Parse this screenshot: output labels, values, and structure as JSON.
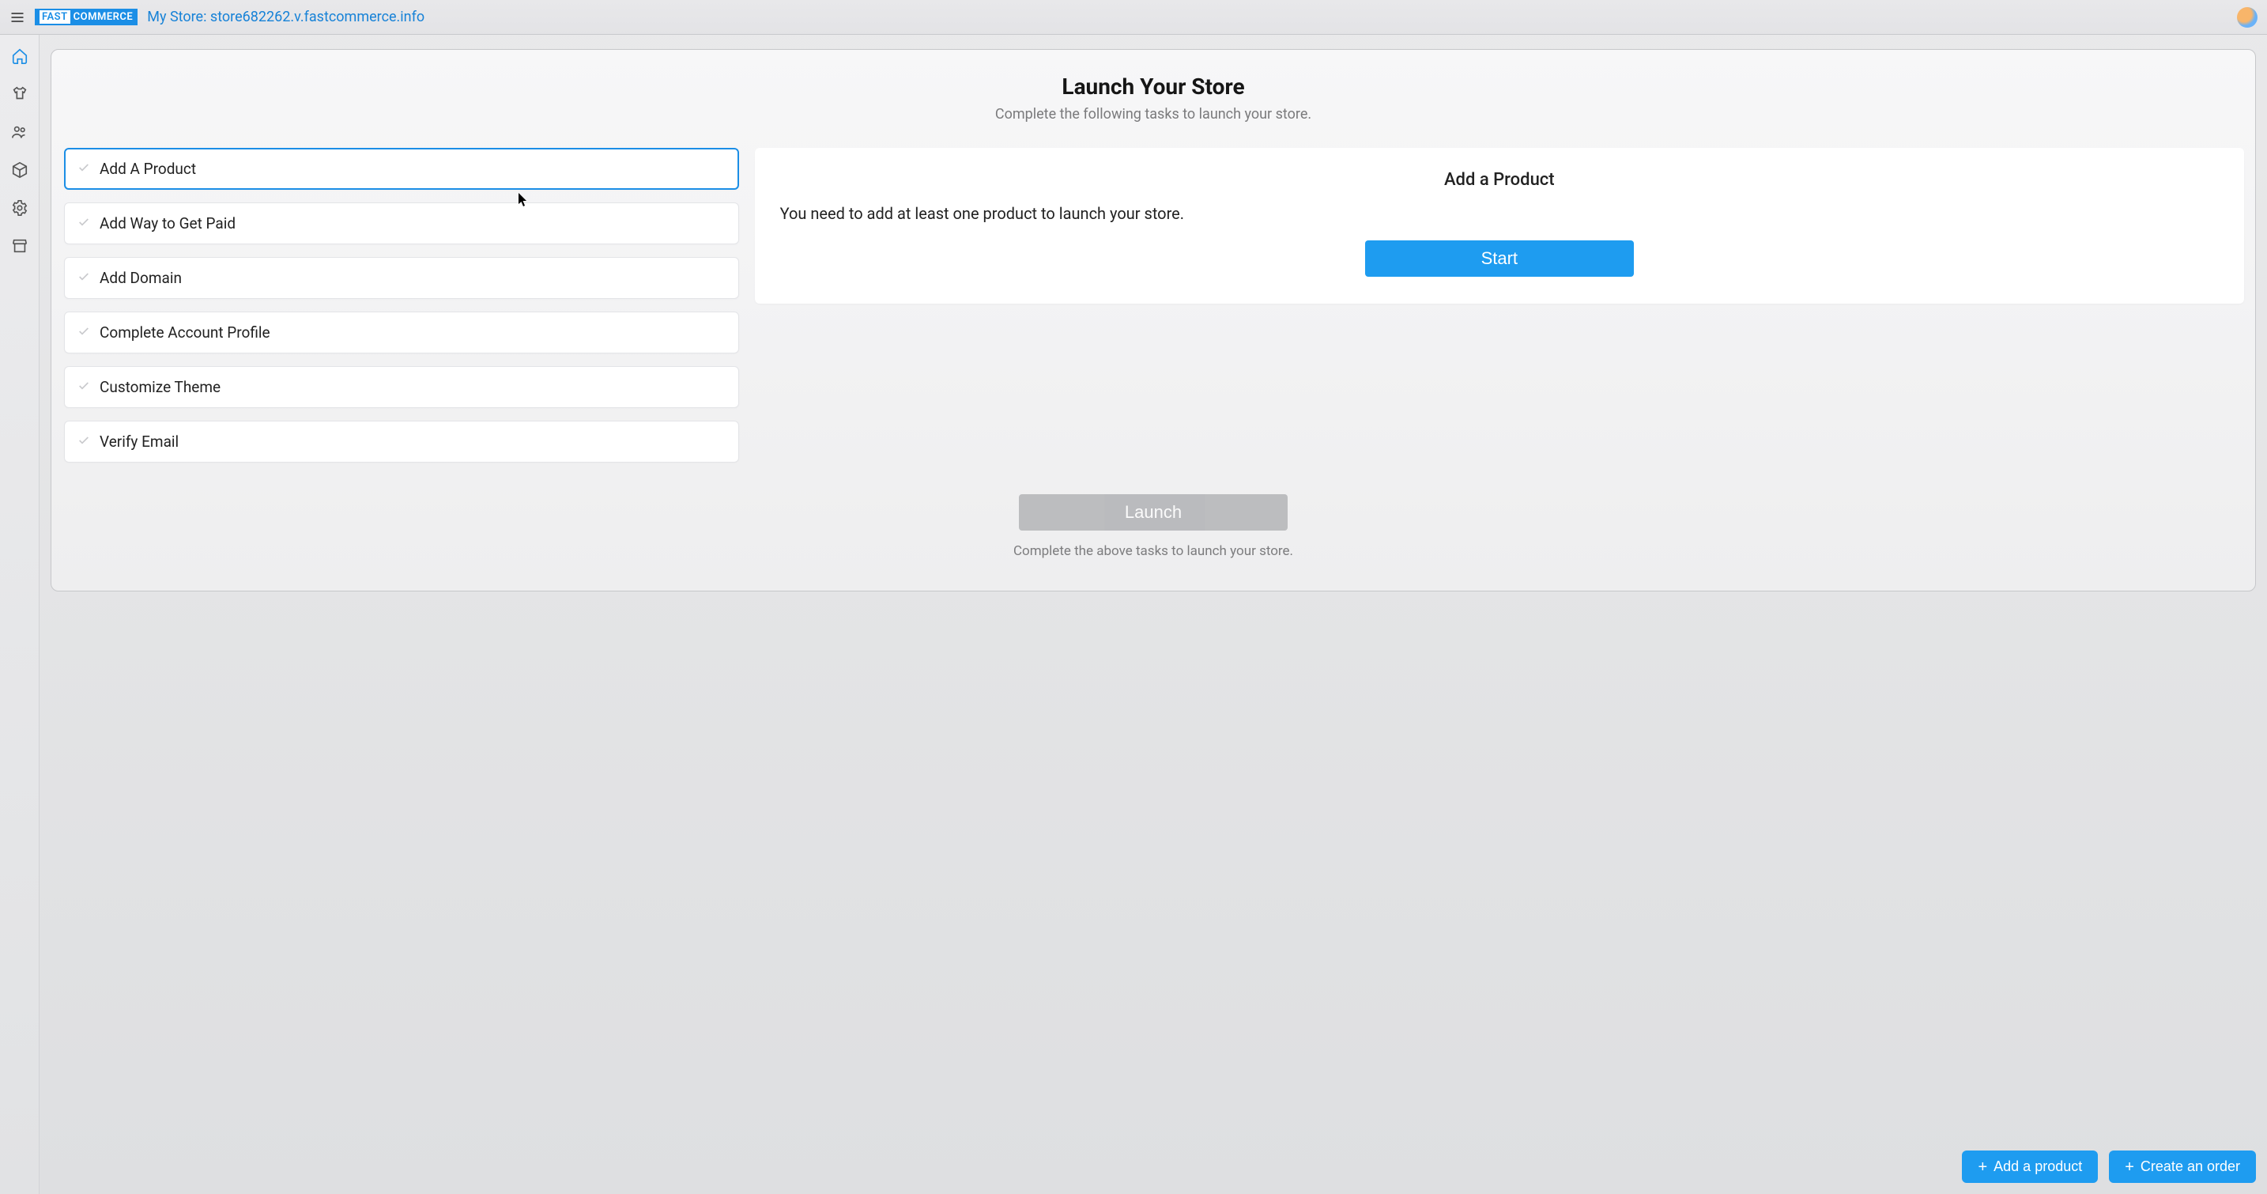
{
  "header": {
    "logo_text": "FASTCOMMERCE",
    "store_label": "My Store: store682262.v.fastcommerce.info"
  },
  "rail": {
    "items": [
      "home",
      "products",
      "customers",
      "orders",
      "settings",
      "storefront"
    ]
  },
  "main": {
    "title": "Launch Your Store",
    "subtitle": "Complete the following tasks to launch your store.",
    "tasks": [
      {
        "label": "Add A Product"
      },
      {
        "label": "Add Way to Get Paid"
      },
      {
        "label": "Add Domain"
      },
      {
        "label": "Complete Account Profile"
      },
      {
        "label": "Customize Theme"
      },
      {
        "label": "Verify Email"
      }
    ],
    "detail": {
      "title": "Add a Product",
      "description": "You need to add at least one product to launch your store.",
      "start_label": "Start"
    },
    "footer": {
      "launch_label": "Launch",
      "note": "Complete the above tasks to launch your store."
    }
  },
  "fab": {
    "add_product": "Add a product",
    "create_order": "Create an order"
  }
}
